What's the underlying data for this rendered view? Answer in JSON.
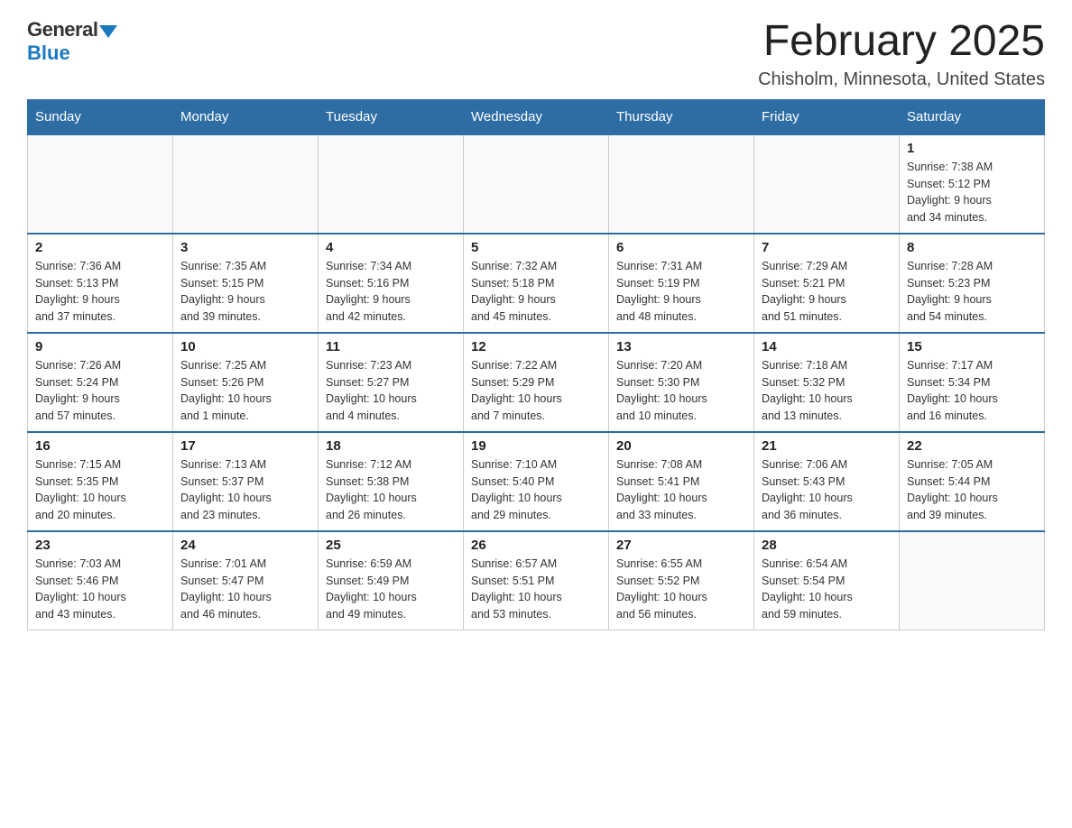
{
  "logo": {
    "general": "General",
    "blue": "Blue"
  },
  "title": "February 2025",
  "subtitle": "Chisholm, Minnesota, United States",
  "days_of_week": [
    "Sunday",
    "Monday",
    "Tuesday",
    "Wednesday",
    "Thursday",
    "Friday",
    "Saturday"
  ],
  "weeks": [
    [
      {
        "day": "",
        "info": ""
      },
      {
        "day": "",
        "info": ""
      },
      {
        "day": "",
        "info": ""
      },
      {
        "day": "",
        "info": ""
      },
      {
        "day": "",
        "info": ""
      },
      {
        "day": "",
        "info": ""
      },
      {
        "day": "1",
        "info": "Sunrise: 7:38 AM\nSunset: 5:12 PM\nDaylight: 9 hours\nand 34 minutes."
      }
    ],
    [
      {
        "day": "2",
        "info": "Sunrise: 7:36 AM\nSunset: 5:13 PM\nDaylight: 9 hours\nand 37 minutes."
      },
      {
        "day": "3",
        "info": "Sunrise: 7:35 AM\nSunset: 5:15 PM\nDaylight: 9 hours\nand 39 minutes."
      },
      {
        "day": "4",
        "info": "Sunrise: 7:34 AM\nSunset: 5:16 PM\nDaylight: 9 hours\nand 42 minutes."
      },
      {
        "day": "5",
        "info": "Sunrise: 7:32 AM\nSunset: 5:18 PM\nDaylight: 9 hours\nand 45 minutes."
      },
      {
        "day": "6",
        "info": "Sunrise: 7:31 AM\nSunset: 5:19 PM\nDaylight: 9 hours\nand 48 minutes."
      },
      {
        "day": "7",
        "info": "Sunrise: 7:29 AM\nSunset: 5:21 PM\nDaylight: 9 hours\nand 51 minutes."
      },
      {
        "day": "8",
        "info": "Sunrise: 7:28 AM\nSunset: 5:23 PM\nDaylight: 9 hours\nand 54 minutes."
      }
    ],
    [
      {
        "day": "9",
        "info": "Sunrise: 7:26 AM\nSunset: 5:24 PM\nDaylight: 9 hours\nand 57 minutes."
      },
      {
        "day": "10",
        "info": "Sunrise: 7:25 AM\nSunset: 5:26 PM\nDaylight: 10 hours\nand 1 minute."
      },
      {
        "day": "11",
        "info": "Sunrise: 7:23 AM\nSunset: 5:27 PM\nDaylight: 10 hours\nand 4 minutes."
      },
      {
        "day": "12",
        "info": "Sunrise: 7:22 AM\nSunset: 5:29 PM\nDaylight: 10 hours\nand 7 minutes."
      },
      {
        "day": "13",
        "info": "Sunrise: 7:20 AM\nSunset: 5:30 PM\nDaylight: 10 hours\nand 10 minutes."
      },
      {
        "day": "14",
        "info": "Sunrise: 7:18 AM\nSunset: 5:32 PM\nDaylight: 10 hours\nand 13 minutes."
      },
      {
        "day": "15",
        "info": "Sunrise: 7:17 AM\nSunset: 5:34 PM\nDaylight: 10 hours\nand 16 minutes."
      }
    ],
    [
      {
        "day": "16",
        "info": "Sunrise: 7:15 AM\nSunset: 5:35 PM\nDaylight: 10 hours\nand 20 minutes."
      },
      {
        "day": "17",
        "info": "Sunrise: 7:13 AM\nSunset: 5:37 PM\nDaylight: 10 hours\nand 23 minutes."
      },
      {
        "day": "18",
        "info": "Sunrise: 7:12 AM\nSunset: 5:38 PM\nDaylight: 10 hours\nand 26 minutes."
      },
      {
        "day": "19",
        "info": "Sunrise: 7:10 AM\nSunset: 5:40 PM\nDaylight: 10 hours\nand 29 minutes."
      },
      {
        "day": "20",
        "info": "Sunrise: 7:08 AM\nSunset: 5:41 PM\nDaylight: 10 hours\nand 33 minutes."
      },
      {
        "day": "21",
        "info": "Sunrise: 7:06 AM\nSunset: 5:43 PM\nDaylight: 10 hours\nand 36 minutes."
      },
      {
        "day": "22",
        "info": "Sunrise: 7:05 AM\nSunset: 5:44 PM\nDaylight: 10 hours\nand 39 minutes."
      }
    ],
    [
      {
        "day": "23",
        "info": "Sunrise: 7:03 AM\nSunset: 5:46 PM\nDaylight: 10 hours\nand 43 minutes."
      },
      {
        "day": "24",
        "info": "Sunrise: 7:01 AM\nSunset: 5:47 PM\nDaylight: 10 hours\nand 46 minutes."
      },
      {
        "day": "25",
        "info": "Sunrise: 6:59 AM\nSunset: 5:49 PM\nDaylight: 10 hours\nand 49 minutes."
      },
      {
        "day": "26",
        "info": "Sunrise: 6:57 AM\nSunset: 5:51 PM\nDaylight: 10 hours\nand 53 minutes."
      },
      {
        "day": "27",
        "info": "Sunrise: 6:55 AM\nSunset: 5:52 PM\nDaylight: 10 hours\nand 56 minutes."
      },
      {
        "day": "28",
        "info": "Sunrise: 6:54 AM\nSunset: 5:54 PM\nDaylight: 10 hours\nand 59 minutes."
      },
      {
        "day": "",
        "info": ""
      }
    ]
  ]
}
